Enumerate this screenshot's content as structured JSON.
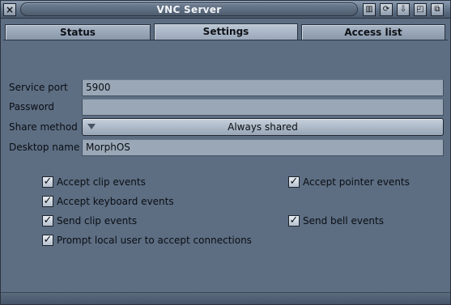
{
  "window": {
    "title": "VNC Server"
  },
  "title_gadgets": [
    {
      "name": "iconify-gadget",
      "glyph": "▥"
    },
    {
      "name": "snapshot-gadget",
      "glyph": "⟳"
    },
    {
      "name": "popup-gadget",
      "glyph": "⇩"
    },
    {
      "name": "zoom-gadget",
      "glyph": "◰"
    },
    {
      "name": "depth-gadget",
      "glyph": "⧉"
    }
  ],
  "close_glyph": "×",
  "tabs": [
    {
      "label": "Status",
      "active": false
    },
    {
      "label": "Settings",
      "active": true
    },
    {
      "label": "Access list",
      "active": false
    }
  ],
  "form": {
    "service_port": {
      "label": "Service port",
      "value": "5900"
    },
    "password": {
      "label": "Password",
      "value": ""
    },
    "share_method": {
      "label": "Share method",
      "value": "Always shared"
    },
    "desktop_name": {
      "label": "Desktop name",
      "value": "MorphOS"
    }
  },
  "checkboxes": {
    "accept_clip_events": {
      "label": "Accept clip events",
      "checked": true
    },
    "accept_pointer_events": {
      "label": "Accept pointer events",
      "checked": true
    },
    "accept_keyboard_events": {
      "label": "Accept keyboard events",
      "checked": true
    },
    "send_clip_events": {
      "label": "Send clip events",
      "checked": true
    },
    "send_bell_events": {
      "label": "Send bell events",
      "checked": true
    },
    "prompt_local_user": {
      "label": "Prompt local user to accept connections",
      "checked": true
    }
  },
  "check_glyph": "✓"
}
